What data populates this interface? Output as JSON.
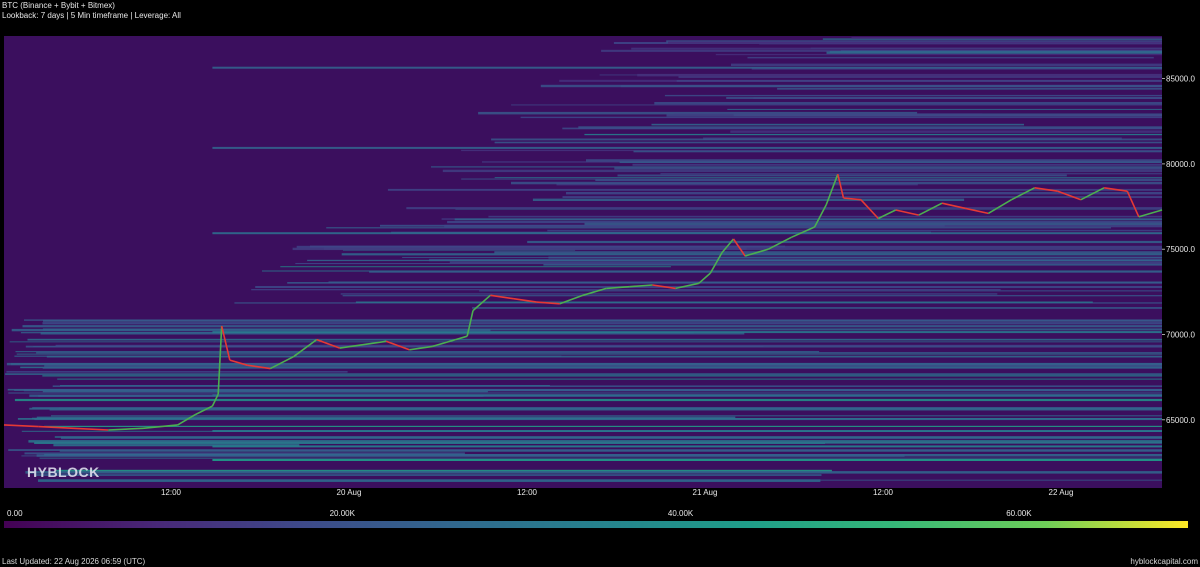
{
  "header": {
    "title": "BTC (Binance + Bybit + Bitmex)",
    "subtitle": "Lookback: 7 days | 5 Min timeframe | Leverage: All"
  },
  "watermark": "HYBLOCK",
  "footer": {
    "last_updated": "Last Updated: 22 Aug 2026 06:59 (UTC)",
    "site": "hyblockcapital.com"
  },
  "colors": {
    "background": "#000000",
    "heatmap_base": "#3b0f5e",
    "candle_up": "#4caf50",
    "candle_down": "#e53935"
  },
  "chart_data": {
    "type": "heatmap",
    "overlay": "candlestick price line",
    "x_tick_labels": [
      "12:00",
      "20 Aug",
      "12:00",
      "21 Aug",
      "12:00",
      "22 Aug"
    ],
    "y_tick_labels": [
      "65000.0",
      "70000.0",
      "75000.0",
      "80000.0",
      "85000.0"
    ],
    "y_ticks": [
      65000,
      70000,
      75000,
      80000,
      85000
    ],
    "ylim": [
      61000,
      87500
    ],
    "y_axis_position": "right",
    "grid": false,
    "colorscale": "viridis",
    "colorbar": {
      "position": "bottom",
      "range": [
        0,
        70000
      ],
      "tick_labels": [
        "0.00",
        "20.00K",
        "40.00K",
        "60.00K"
      ],
      "ticks": [
        0,
        20000,
        40000,
        60000
      ]
    },
    "price_series": {
      "name": "",
      "points": [
        {
          "t": 0.0,
          "price": 64700
        },
        {
          "t": 0.03,
          "price": 64600
        },
        {
          "t": 0.06,
          "price": 64500
        },
        {
          "t": 0.09,
          "price": 64400
        },
        {
          "t": 0.12,
          "price": 64500
        },
        {
          "t": 0.15,
          "price": 64700
        },
        {
          "t": 0.165,
          "price": 65300
        },
        {
          "t": 0.18,
          "price": 65800
        },
        {
          "t": 0.185,
          "price": 66500
        },
        {
          "t": 0.188,
          "price": 70500
        },
        {
          "t": 0.195,
          "price": 68500
        },
        {
          "t": 0.21,
          "price": 68200
        },
        {
          "t": 0.23,
          "price": 68000
        },
        {
          "t": 0.25,
          "price": 68700
        },
        {
          "t": 0.27,
          "price": 69700
        },
        {
          "t": 0.29,
          "price": 69200
        },
        {
          "t": 0.31,
          "price": 69400
        },
        {
          "t": 0.33,
          "price": 69600
        },
        {
          "t": 0.35,
          "price": 69100
        },
        {
          "t": 0.37,
          "price": 69300
        },
        {
          "t": 0.39,
          "price": 69700
        },
        {
          "t": 0.4,
          "price": 69900
        },
        {
          "t": 0.405,
          "price": 71400
        },
        {
          "t": 0.42,
          "price": 72300
        },
        {
          "t": 0.44,
          "price": 72100
        },
        {
          "t": 0.46,
          "price": 71900
        },
        {
          "t": 0.48,
          "price": 71800
        },
        {
          "t": 0.5,
          "price": 72300
        },
        {
          "t": 0.52,
          "price": 72700
        },
        {
          "t": 0.54,
          "price": 72800
        },
        {
          "t": 0.56,
          "price": 72900
        },
        {
          "t": 0.58,
          "price": 72700
        },
        {
          "t": 0.6,
          "price": 73000
        },
        {
          "t": 0.61,
          "price": 73600
        },
        {
          "t": 0.62,
          "price": 74800
        },
        {
          "t": 0.63,
          "price": 75600
        },
        {
          "t": 0.64,
          "price": 74600
        },
        {
          "t": 0.66,
          "price": 75000
        },
        {
          "t": 0.68,
          "price": 75700
        },
        {
          "t": 0.7,
          "price": 76300
        },
        {
          "t": 0.71,
          "price": 77600
        },
        {
          "t": 0.72,
          "price": 79400
        },
        {
          "t": 0.725,
          "price": 78000
        },
        {
          "t": 0.74,
          "price": 77900
        },
        {
          "t": 0.755,
          "price": 76800
        },
        {
          "t": 0.77,
          "price": 77300
        },
        {
          "t": 0.79,
          "price": 77000
        },
        {
          "t": 0.81,
          "price": 77700
        },
        {
          "t": 0.83,
          "price": 77400
        },
        {
          "t": 0.85,
          "price": 77100
        },
        {
          "t": 0.87,
          "price": 77900
        },
        {
          "t": 0.89,
          "price": 78600
        },
        {
          "t": 0.91,
          "price": 78400
        },
        {
          "t": 0.93,
          "price": 77900
        },
        {
          "t": 0.95,
          "price": 78600
        },
        {
          "t": 0.97,
          "price": 78400
        },
        {
          "t": 0.98,
          "price": 76900
        },
        {
          "t": 1.0,
          "price": 77300
        }
      ]
    }
  }
}
